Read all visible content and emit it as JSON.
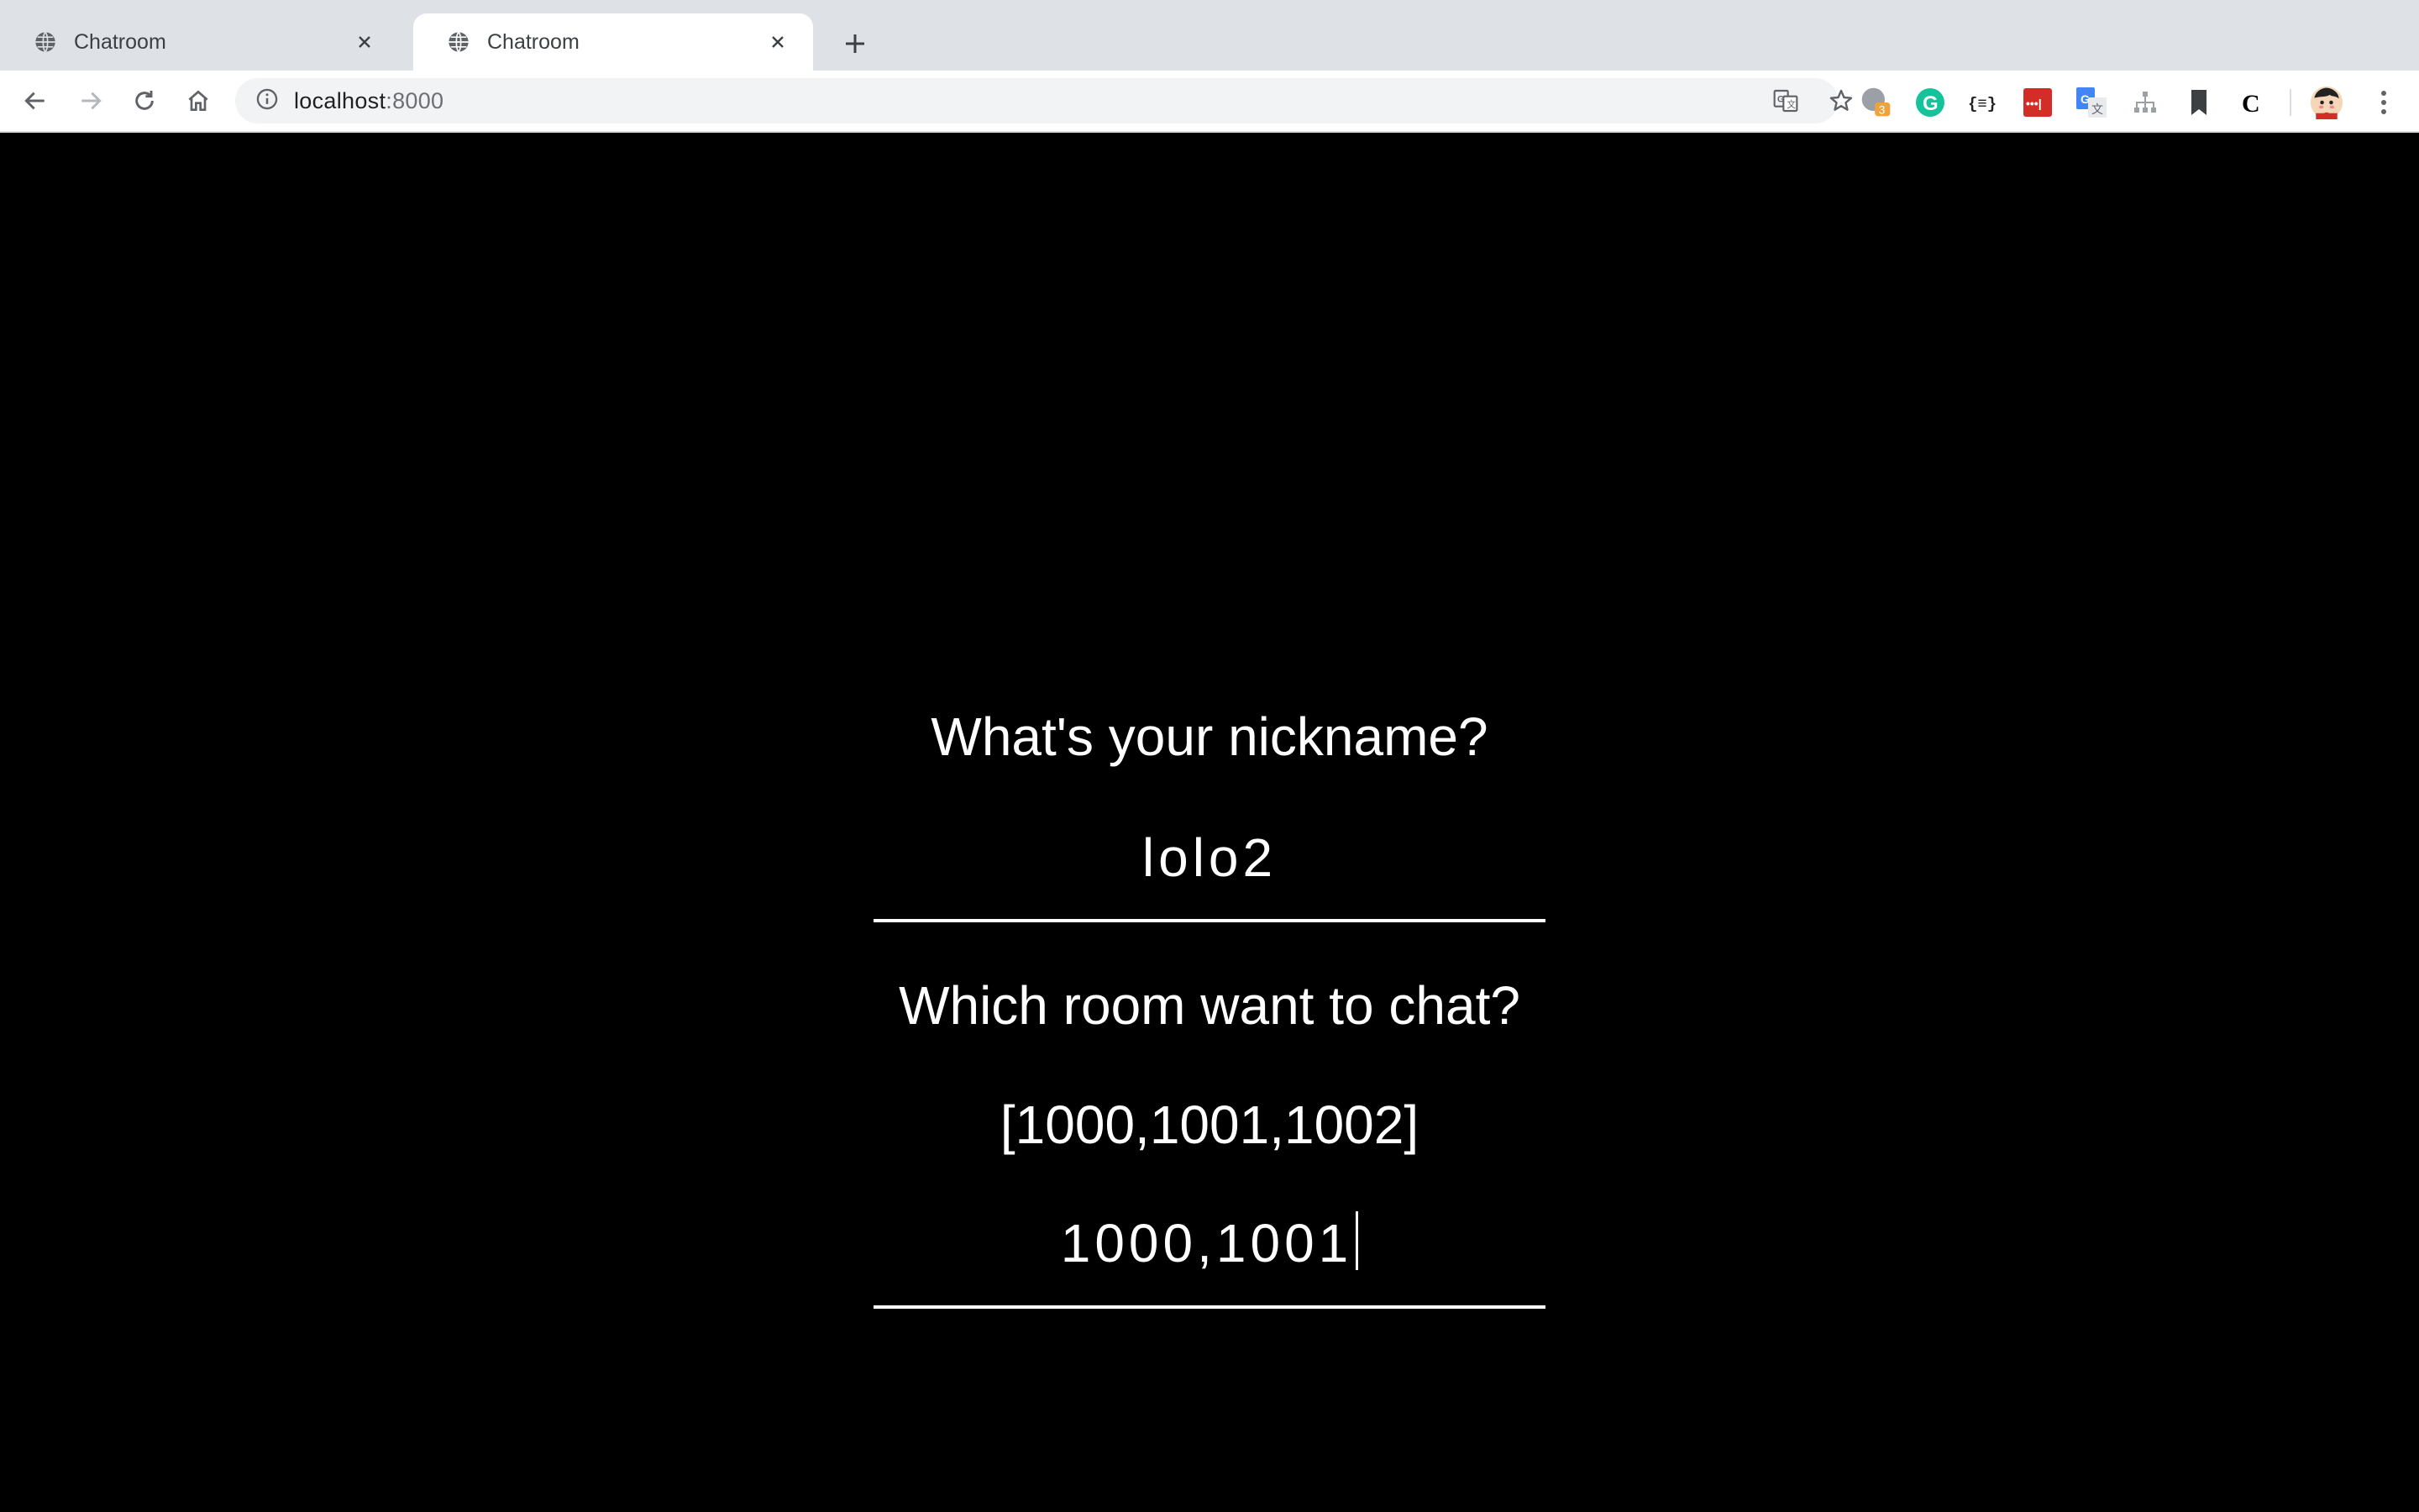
{
  "browser": {
    "tabs": [
      {
        "title": "Chatroom",
        "active": false,
        "favicon": "globe-icon"
      },
      {
        "title": "Chatroom",
        "active": true,
        "favicon": "globe-icon"
      }
    ],
    "address": {
      "host": "localhost",
      "port": ":8000",
      "security_icon": "info-icon"
    },
    "extensions": [
      {
        "name": "extension-badge-icon",
        "badge": "3"
      },
      {
        "name": "grammarly-icon",
        "letter": "G"
      },
      {
        "name": "json-formatter-icon",
        "label": "{≡}"
      },
      {
        "name": "lastpass-icon",
        "label": "•••|"
      },
      {
        "name": "google-translate-icon"
      },
      {
        "name": "sitemap-icon"
      },
      {
        "name": "bookmark-icon"
      },
      {
        "name": "c-extension-icon",
        "letter": "C"
      }
    ]
  },
  "form": {
    "nickname_label": "What's your nickname?",
    "nickname_value": "lolo2",
    "room_label": "Which room want to chat?",
    "room_options": "[1000,1001,1002]",
    "room_value": "1000,1001"
  },
  "colors": {
    "page_background": "#000000",
    "text": "#ffffff",
    "tabstrip": "#dee1e6",
    "omnibox": "#f1f3f4"
  }
}
